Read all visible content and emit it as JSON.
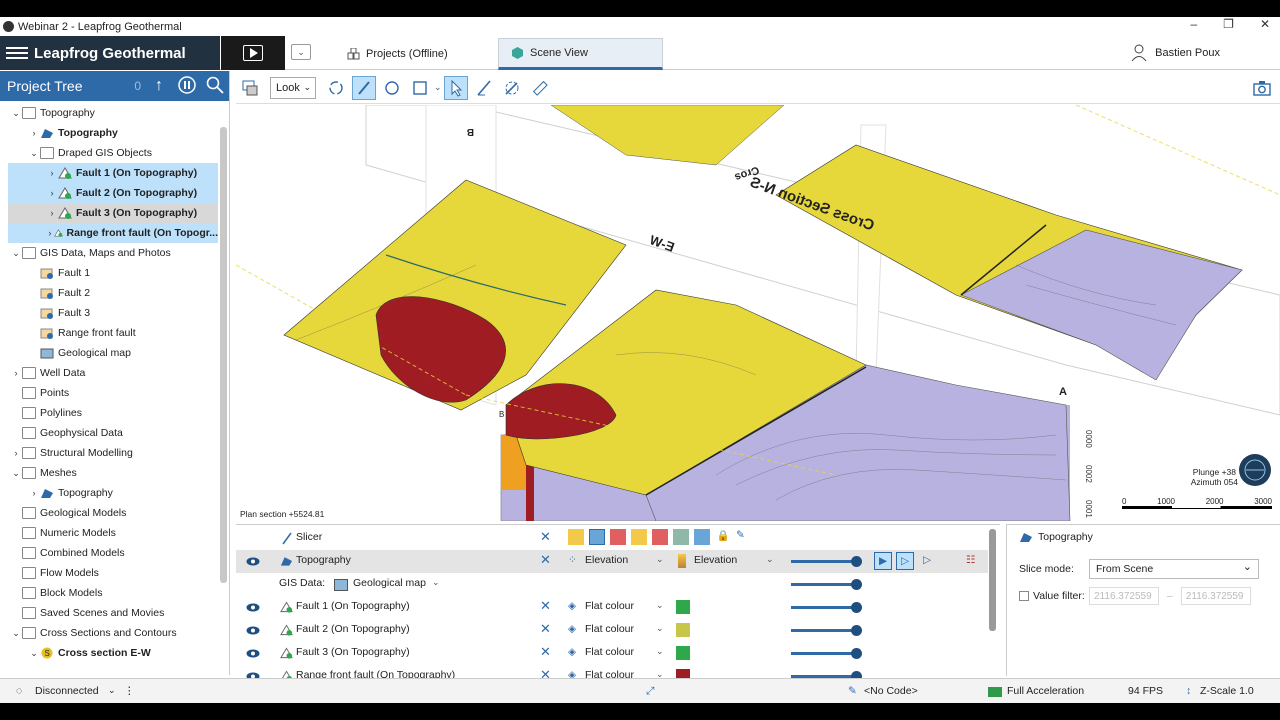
{
  "window": {
    "title": "Webinar 2 - Leapfrog Geothermal",
    "controls": [
      "–",
      "❐",
      "✕"
    ]
  },
  "nav": {
    "brand": "Leapfrog Geothermal",
    "tabs": [
      {
        "label": "Projects (Offline)"
      },
      {
        "label": "Scene View"
      }
    ],
    "user": "Bastien Poux"
  },
  "project_tree": {
    "title": "Project Tree",
    "counter": "0",
    "items": [
      {
        "label": "Topography",
        "level": 0,
        "chev": "⌄",
        "icon": "folder-icon"
      },
      {
        "label": "Topography",
        "level": 1,
        "chev": "›",
        "icon": "surface-icon",
        "bold": true
      },
      {
        "label": "Draped GIS Objects",
        "level": 1,
        "chev": "⌄",
        "icon": "folder-icon"
      },
      {
        "label": "Fault 1 (On Topography)",
        "level": 2,
        "chev": "›",
        "icon": "fault-icon",
        "bold": true,
        "state": "sel"
      },
      {
        "label": "Fault 2 (On Topography)",
        "level": 2,
        "chev": "›",
        "icon": "fault-icon",
        "bold": true,
        "state": "sel"
      },
      {
        "label": "Fault 3 (On Topography)",
        "level": 2,
        "chev": "›",
        "icon": "fault-icon",
        "bold": true,
        "state": "sel2"
      },
      {
        "label": "Range front fault (On Topogr...",
        "level": 2,
        "chev": "›",
        "icon": "fault-icon",
        "bold": true,
        "state": "sel"
      },
      {
        "label": "GIS Data, Maps and Photos",
        "level": 0,
        "chev": "⌄",
        "icon": "folder-icon"
      },
      {
        "label": "Fault 1",
        "level": 1,
        "chev": "",
        "icon": "gis-icon"
      },
      {
        "label": "Fault 2",
        "level": 1,
        "chev": "",
        "icon": "gis-icon"
      },
      {
        "label": "Fault 3",
        "level": 1,
        "chev": "",
        "icon": "gis-icon"
      },
      {
        "label": "Range front fault",
        "level": 1,
        "chev": "",
        "icon": "gis-icon"
      },
      {
        "label": "Geological map",
        "level": 1,
        "chev": "",
        "icon": "map-icon"
      },
      {
        "label": "Well Data",
        "level": 0,
        "chev": "›",
        "icon": "folder-icon"
      },
      {
        "label": "Points",
        "level": 0,
        "chev": "",
        "icon": "folder-icon"
      },
      {
        "label": "Polylines",
        "level": 0,
        "chev": "",
        "icon": "folder-icon"
      },
      {
        "label": "Geophysical Data",
        "level": 0,
        "chev": "",
        "icon": "folder-icon"
      },
      {
        "label": "Structural Modelling",
        "level": 0,
        "chev": "›",
        "icon": "folder-icon"
      },
      {
        "label": "Meshes",
        "level": 0,
        "chev": "⌄",
        "icon": "folder-icon"
      },
      {
        "label": "Topography",
        "level": 1,
        "chev": "›",
        "icon": "surface-icon"
      },
      {
        "label": "Geological Models",
        "level": 0,
        "chev": "",
        "icon": "folder-icon"
      },
      {
        "label": "Numeric Models",
        "level": 0,
        "chev": "",
        "icon": "folder-icon"
      },
      {
        "label": "Combined Models",
        "level": 0,
        "chev": "",
        "icon": "folder-icon"
      },
      {
        "label": "Flow Models",
        "level": 0,
        "chev": "",
        "icon": "folder-icon"
      },
      {
        "label": "Block Models",
        "level": 0,
        "chev": "",
        "icon": "folder-icon"
      },
      {
        "label": "Saved Scenes and Movies",
        "level": 0,
        "chev": "",
        "icon": "folder-icon"
      },
      {
        "label": "Cross Sections and Contours",
        "level": 0,
        "chev": "⌄",
        "icon": "folder-icon"
      },
      {
        "label": "Cross section E-W",
        "level": 1,
        "chev": "⌄",
        "icon": "section-icon",
        "bold": true
      }
    ]
  },
  "toolbar": {
    "look_label": "Look"
  },
  "scene": {
    "plan_section": "Plan section +5524.81",
    "labels": {
      "cross_ns": "Cross Section N-S",
      "cross_ew": "E-W",
      "cros": "Cros",
      "a": "A",
      "b": "B",
      "b2": "B"
    },
    "depth_ticks": [
      "0000",
      "0002",
      "0001"
    ],
    "plunge": "Plunge +38",
    "azimuth": "Azimuth 054",
    "scale_ticks": [
      "0",
      "1000",
      "2000",
      "3000"
    ],
    "colors": {
      "yellow": "#e6d83a",
      "red": "#9e1c22",
      "lavender": "#b8b2e0"
    }
  },
  "shape_list": {
    "slicer": "Slicer",
    "rows": [
      {
        "label": "Topography",
        "style": "Elevation",
        "colour_label": "Elevation",
        "swatch": "",
        "highlight": true
      },
      {
        "label": "Fault 1 (On Topography)",
        "style": "Flat colour",
        "swatch": "#2ea84a"
      },
      {
        "label": "Fault 2 (On Topography)",
        "style": "Flat colour",
        "swatch": "#c8c64a"
      },
      {
        "label": "Fault 3 (On Topography)",
        "style": "Flat colour",
        "swatch": "#2ea84a"
      },
      {
        "label": "Range front fault (On Topography)",
        "style": "Flat colour",
        "swatch": "#9e1c22"
      }
    ],
    "gis_data_label": "GIS Data:",
    "gis_data_value": "Geological map"
  },
  "properties": {
    "title": "Topography",
    "slice_mode_label": "Slice mode:",
    "slice_mode_value": "From Scene",
    "value_filter_label": "Value filter:",
    "value_filter_min": "2116.372559",
    "value_filter_max": "2116.372559",
    "value_filter_sep": "–"
  },
  "status": {
    "connection": "Disconnected",
    "code": "<No Code>",
    "acceleration": "Full Acceleration",
    "fps": "94 FPS",
    "zscale": "Z-Scale 1.0"
  }
}
